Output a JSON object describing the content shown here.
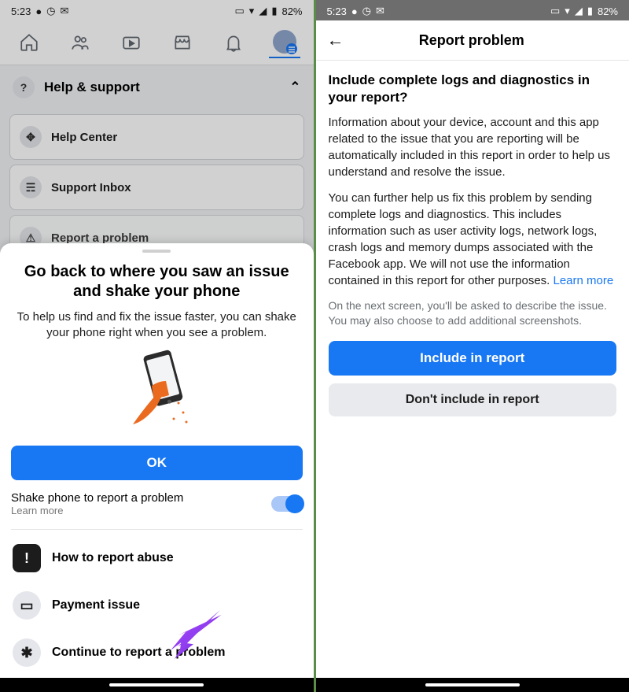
{
  "status": {
    "time": "5:23",
    "battery": "82%"
  },
  "left": {
    "help_section_title": "Help & support",
    "card_help_center": "Help Center",
    "card_support_inbox": "Support Inbox",
    "card_report": "Report a problem",
    "sheet": {
      "title": "Go back to where you saw an issue and shake your phone",
      "subtitle": "To help us find and fix the issue faster, you can shake your phone right when you see a problem.",
      "ok": "OK",
      "toggle_label": "Shake phone to report a problem",
      "toggle_sub": "Learn more",
      "row_abuse": "How to report abuse",
      "row_payment": "Payment issue",
      "row_continue": "Continue to report a problem"
    }
  },
  "right": {
    "header_title": "Report problem",
    "heading": "Include complete logs and diagnostics in your report?",
    "para1": "Information about your device, account and this app related to the issue that you are reporting will be automatically included in this report in order to help us understand and resolve the issue.",
    "para2_a": "You can further help us fix this problem by sending complete logs and diagnostics. This includes information such as user activity logs, network logs, crash logs and memory dumps associated with the Facebook app. We will not use the information contained in this report for other purposes. ",
    "para2_link": "Learn more",
    "hint": "On the next screen, you'll be asked to describe the issue. You may also choose to add additional screenshots.",
    "btn_include": "Include in report",
    "btn_exclude": "Don't include in report"
  }
}
